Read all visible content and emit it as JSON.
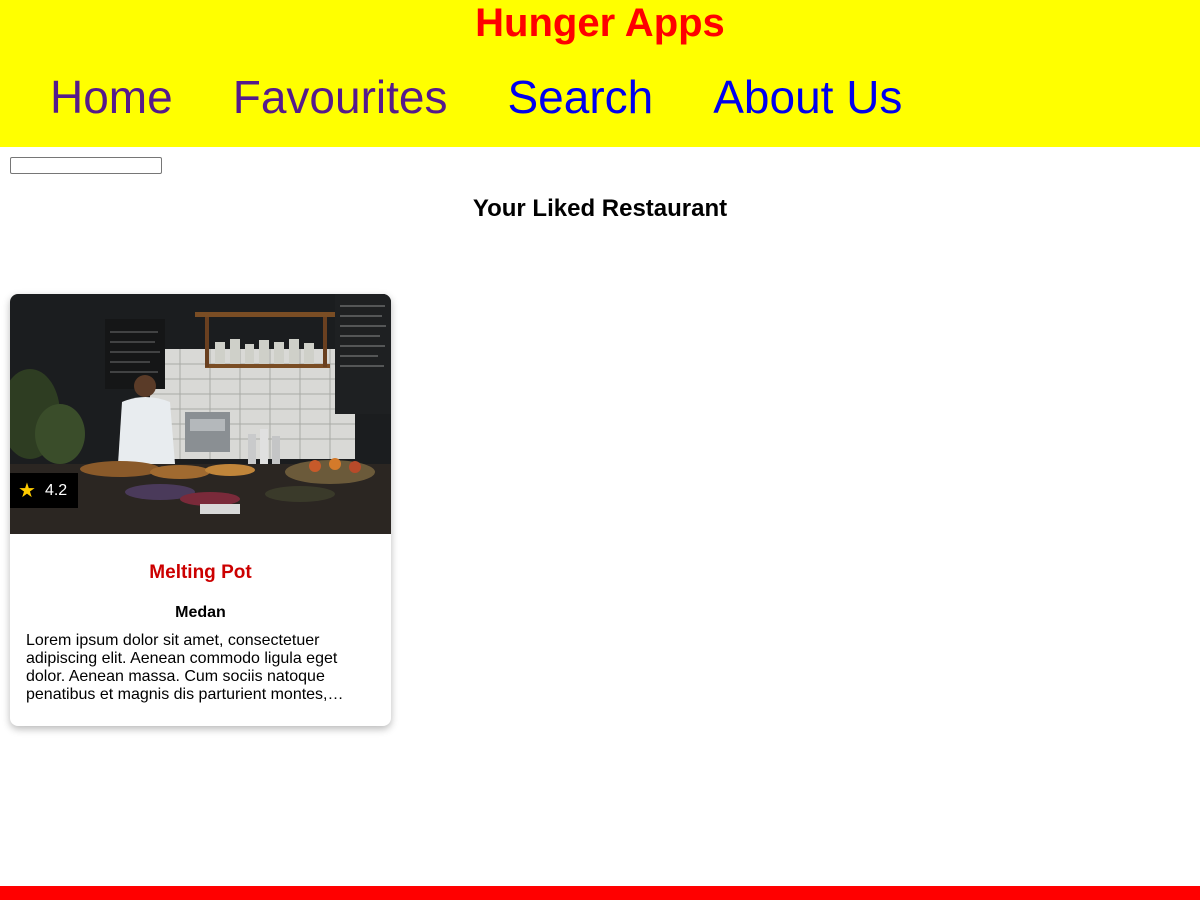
{
  "header": {
    "title": "Hunger Apps",
    "background_color": "#ffff00",
    "title_color": "#ff0000",
    "nav": [
      {
        "label": "Home",
        "state": "visited"
      },
      {
        "label": "Favourites",
        "state": "visited"
      },
      {
        "label": "Search",
        "state": "link"
      },
      {
        "label": "About Us",
        "state": "link"
      }
    ]
  },
  "search": {
    "value": "",
    "placeholder": ""
  },
  "main": {
    "section_title": "Your Liked Restaurant",
    "restaurants": [
      {
        "name": "Melting Pot",
        "city": "Medan",
        "rating": "4.2",
        "rating_icon": "star-icon",
        "image": "restaurant-interior-photo",
        "description": "Lorem ipsum dolor sit amet, consectetuer adipiscing elit. Aenean commodo ligula eget dolor. Aenean massa. Cum sociis natoque penatibus et magnis dis parturient montes,…"
      }
    ]
  },
  "footer": {
    "color": "#ff0000"
  }
}
